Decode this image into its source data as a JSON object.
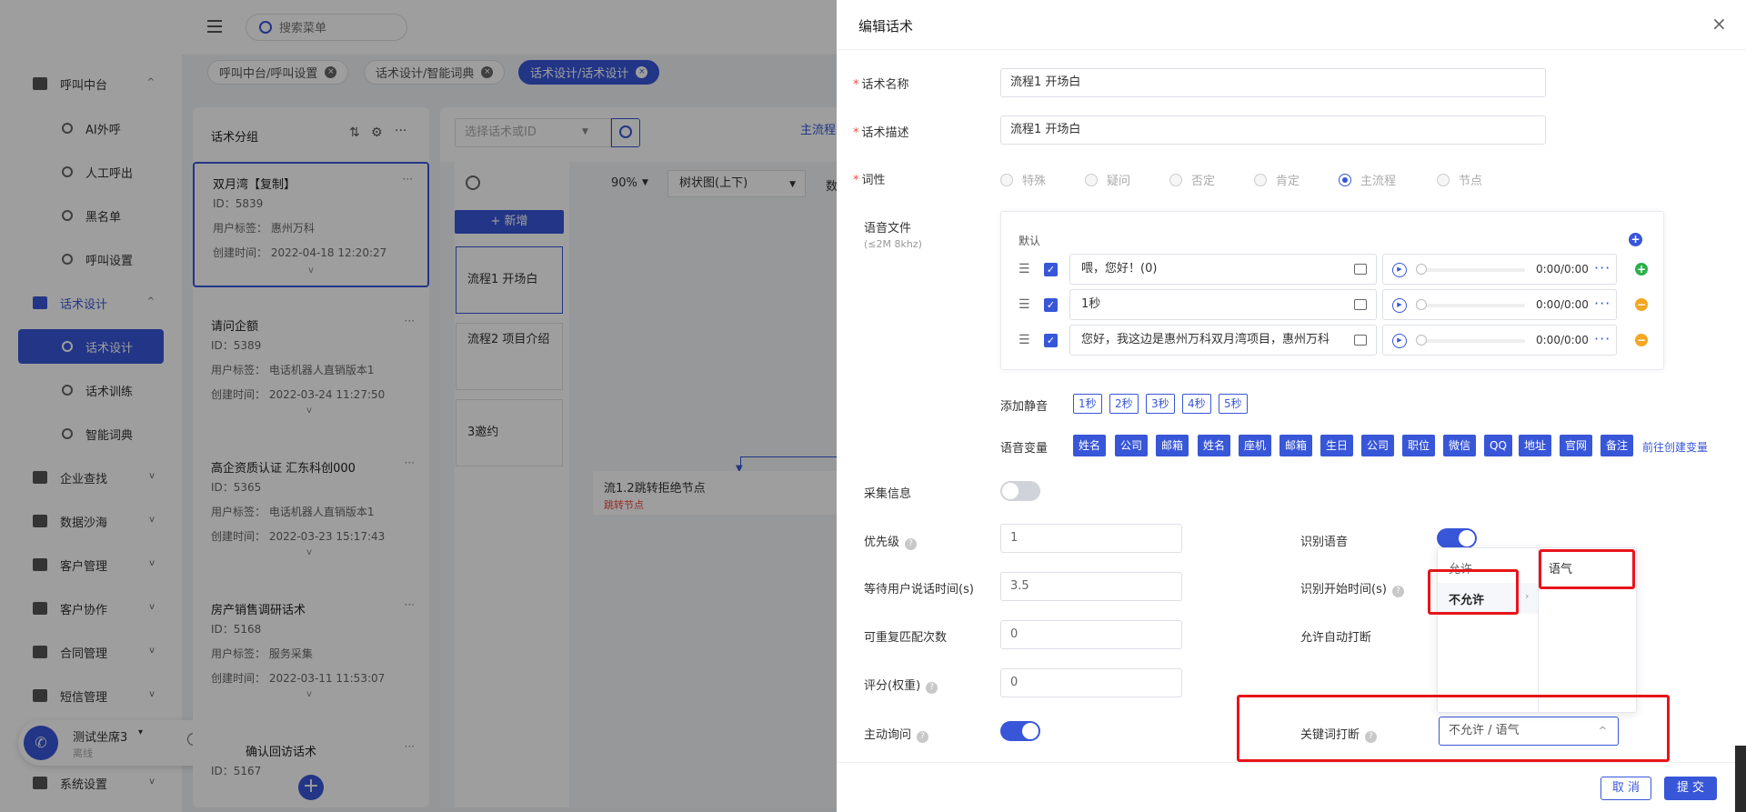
{
  "search_menu": {
    "placeholder": "搜索菜单"
  },
  "nav": {
    "groups": [
      {
        "label": "呼叫中台",
        "icon": "monitor-icon",
        "chev": "^"
      },
      {
        "label": "话术设计",
        "icon": "book-icon",
        "chev": "^"
      },
      {
        "label": "企业查找",
        "icon": "bulb-icon",
        "chev": "v"
      },
      {
        "label": "数据沙海",
        "icon": "chart-icon",
        "chev": "v"
      },
      {
        "label": "客户管理",
        "icon": "contacts-icon",
        "chev": "v"
      },
      {
        "label": "客户协作",
        "icon": "group-icon",
        "chev": "v"
      },
      {
        "label": "合同管理",
        "icon": "clipboard-icon",
        "chev": "v"
      },
      {
        "label": "短信管理",
        "icon": "message-icon",
        "chev": "v"
      },
      {
        "label": "系统设置",
        "icon": "grid-icon",
        "chev": "v"
      }
    ],
    "subs": [
      {
        "label": "AI外呼"
      },
      {
        "label": "人工呼出"
      },
      {
        "label": "黑名单"
      },
      {
        "label": "呼叫设置"
      },
      {
        "label": "话术设计"
      },
      {
        "label": "话术训练"
      },
      {
        "label": "智能词典"
      }
    ]
  },
  "user": {
    "name": "测试坐席3",
    "status": "离线"
  },
  "tabs": [
    {
      "label": "呼叫中台/呼叫设置"
    },
    {
      "label": "话术设计/智能词典"
    },
    {
      "label": "话术设计/话术设计"
    }
  ],
  "groups_panel": {
    "title": "话术分组"
  },
  "cards": [
    {
      "title": "双月湾【复制】",
      "id": "ID：5839",
      "tag": "用户标签：   惠州万科",
      "time": "创建时间：   2022-04-18 12:20:27"
    },
    {
      "title": "请问企额",
      "id": "ID：5389",
      "tag": "用户标签：   电话机器人直销版本1",
      "time": "创建时间：   2022-03-24 11:27:50"
    },
    {
      "title": "高企资质认证 汇东科创000",
      "id": "ID：5365",
      "tag": "用户标签：   电话机器人直销版本1",
      "time": "创建时间：   2022-03-23 15:17:43"
    },
    {
      "title": "房产销售调研话术",
      "id": "ID：5168",
      "tag": "用户标签：   服务采集",
      "time": "创建时间：   2022-03-11 11:53:07"
    },
    {
      "title": "确认回访话术",
      "id": "ID：5167"
    }
  ],
  "flow": {
    "search_placeholder": "选择话术或ID",
    "main_tab": "主流程",
    "zoom": "90%",
    "view": "树状图(上下)",
    "view_suffix": "数",
    "add": "+ 新增",
    "nodes": [
      "流程1 开场白",
      "流程2 项目介绍",
      "3邀约"
    ],
    "jump_node": {
      "title": "流1.2跳转拒绝节点",
      "sub": "跳转节点"
    }
  },
  "drawer": {
    "title": "编辑话术",
    "name_label": "话术名称",
    "name_value": "流程1 开场白",
    "desc_label": "话术描述",
    "desc_value": "流程1 开场白",
    "pos_label": "词性",
    "pos_options": [
      "特殊",
      "疑问",
      "否定",
      "肯定",
      "主流程",
      "节点"
    ],
    "voice_label": "语音文件",
    "voice_hint": "(≤2M 8khz)",
    "voice_default": "默认",
    "voice_rows": [
      {
        "text": "喂，您好！(0)",
        "time": "0:00/0:00"
      },
      {
        "text": "1秒",
        "time": "0:00/0:00"
      },
      {
        "text": "您好，我这边是惠州万科双月湾项目，惠州万科",
        "time": "0:00/0:00"
      }
    ],
    "silence_label": "添加静音",
    "silences": [
      "1秒",
      "2秒",
      "3秒",
      "4秒",
      "5秒"
    ],
    "var_label": "语音变量",
    "vars": [
      "姓名",
      "公司",
      "邮箱",
      "姓名",
      "座机",
      "邮箱",
      "生日",
      "公司",
      "职位",
      "微信",
      "QQ",
      "地址",
      "官网",
      "备注"
    ],
    "var_link": "前往创建变量",
    "collect_label": "采集信息",
    "priority_label": "优先级",
    "priority_value": "1",
    "wait_label": "等待用户说话时间(s)",
    "wait_value": "3.5",
    "repeat_label": "可重复匹配次数",
    "repeat_value": "0",
    "score_label": "评分(权重)",
    "score_value": "0",
    "ask_label": "主动询问",
    "recog_label": "识别语音",
    "recog_start_label": "识别开始时间(s)",
    "auto_break_label": "允许自动打断",
    "kw_break_label": "关键词打断",
    "kw_break_value": "不允许 / 语气",
    "cascader_col1": [
      "允许",
      "不允许"
    ],
    "cascader_col2": [
      "语气"
    ],
    "cancel": "取 消",
    "submit": "提 交"
  }
}
